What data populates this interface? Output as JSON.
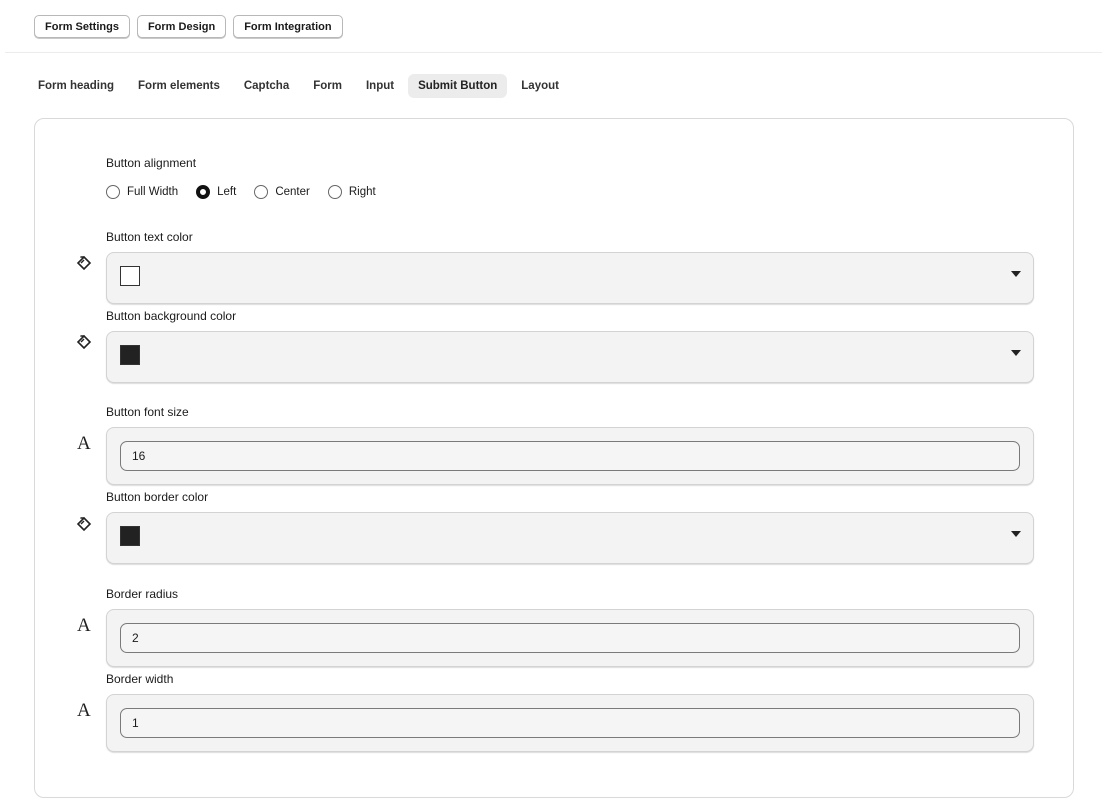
{
  "top_tabs": [
    "Form Settings",
    "Form Design",
    "Form Integration"
  ],
  "sub_tabs": [
    "Form heading",
    "Form elements",
    "Captcha",
    "Form",
    "Input",
    "Submit Button",
    "Layout"
  ],
  "active_sub_tab": "Submit Button",
  "alignment": {
    "label": "Button alignment",
    "options": [
      "Full Width",
      "Left",
      "Center",
      "Right"
    ],
    "selected": "Left"
  },
  "fields": {
    "text_color": {
      "label": "Button text color",
      "swatch": "#ffffff",
      "icon": "paint-bucket-icon"
    },
    "background_color": {
      "label": "Button background color",
      "swatch": "#222222",
      "icon": "paint-bucket-icon"
    },
    "font_size": {
      "label": "Button font size",
      "value": "16",
      "icon": "font-icon",
      "icon_glyph": "A"
    },
    "border_color": {
      "label": "Button border color",
      "swatch": "#222222",
      "icon": "paint-bucket-icon"
    },
    "border_radius": {
      "label": "Border radius",
      "value": "2",
      "icon": "font-icon",
      "icon_glyph": "A"
    },
    "border_width": {
      "label": "Border width",
      "value": "1",
      "icon": "font-icon",
      "icon_glyph": "A"
    }
  }
}
